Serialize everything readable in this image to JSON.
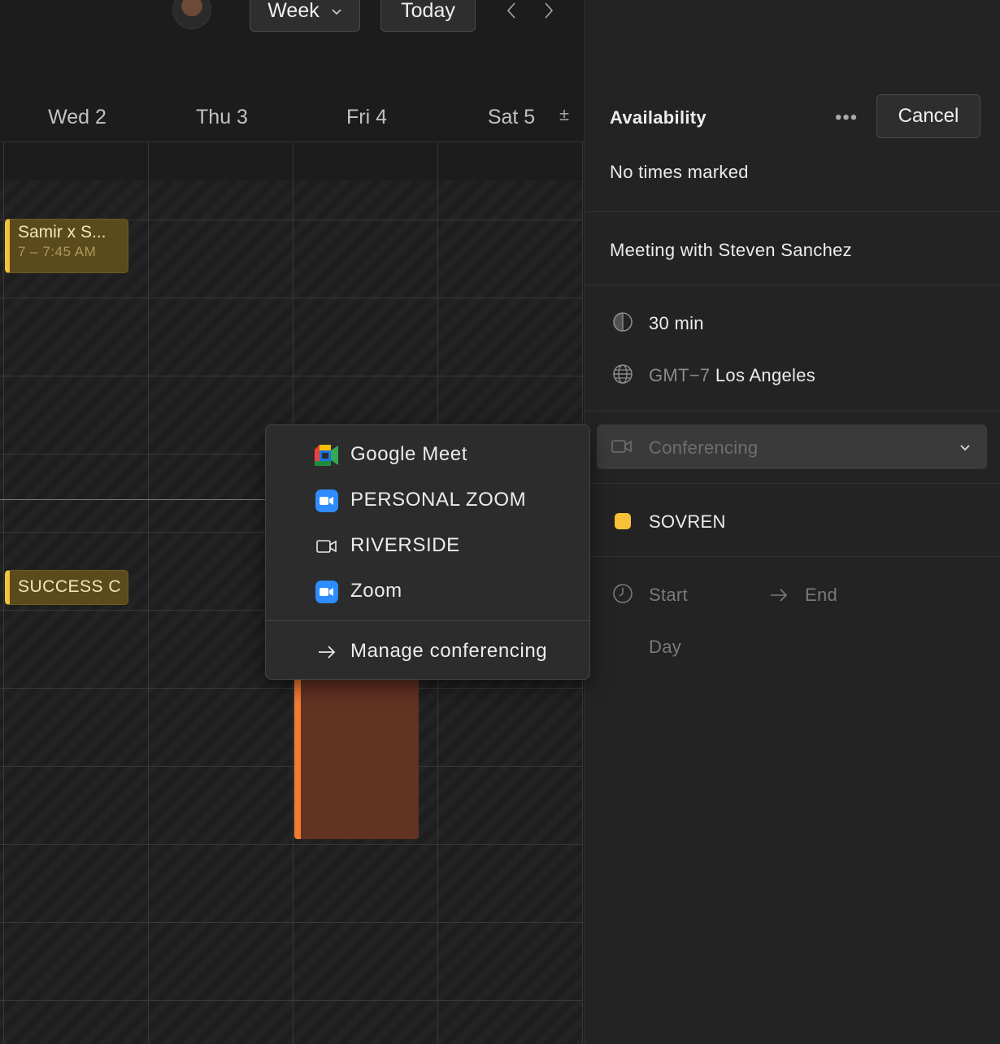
{
  "toolbar": {
    "view_label": "Week",
    "today_label": "Today",
    "icons": [
      "avatar",
      "chevron-down-icon",
      "chevron-left-icon",
      "chevron-right-icon"
    ]
  },
  "days": [
    {
      "label": "Wed 2"
    },
    {
      "label": "Thu 3"
    },
    {
      "label": "Fri 4"
    },
    {
      "label": "Sat 5"
    }
  ],
  "timezone_toggle": "±",
  "events": [
    {
      "title": "Samir x S...",
      "time": "7 – 7:45 AM",
      "color": "#f2c43c"
    },
    {
      "title": "SUCCESS C",
      "time": "",
      "color": "#f2c43c"
    },
    {
      "title": "",
      "time": "",
      "color": "#f27a35"
    }
  ],
  "panel": {
    "title": "Availability",
    "more_label": "•••",
    "cancel_label": "Cancel",
    "availability_status": "No times marked",
    "meeting_title": "Meeting with Steven Sanchez",
    "duration": "30 min",
    "timezone_offset": "GMT−7",
    "timezone_city": "Los Angeles",
    "conferencing_placeholder": "Conferencing",
    "calendar_name": "SOVREN",
    "calendar_color": "#f7c23a",
    "start_label": "Start",
    "end_label": "End",
    "day_label": "Day"
  },
  "conferencing_menu": {
    "items": [
      {
        "label": "Google Meet",
        "icon": "google-meet-icon"
      },
      {
        "label": "PERSONAL ZOOM",
        "icon": "zoom-icon"
      },
      {
        "label": "RIVERSIDE",
        "icon": "video-camera-icon"
      },
      {
        "label": "Zoom",
        "icon": "zoom-icon"
      }
    ],
    "manage_label": "Manage conferencing"
  }
}
